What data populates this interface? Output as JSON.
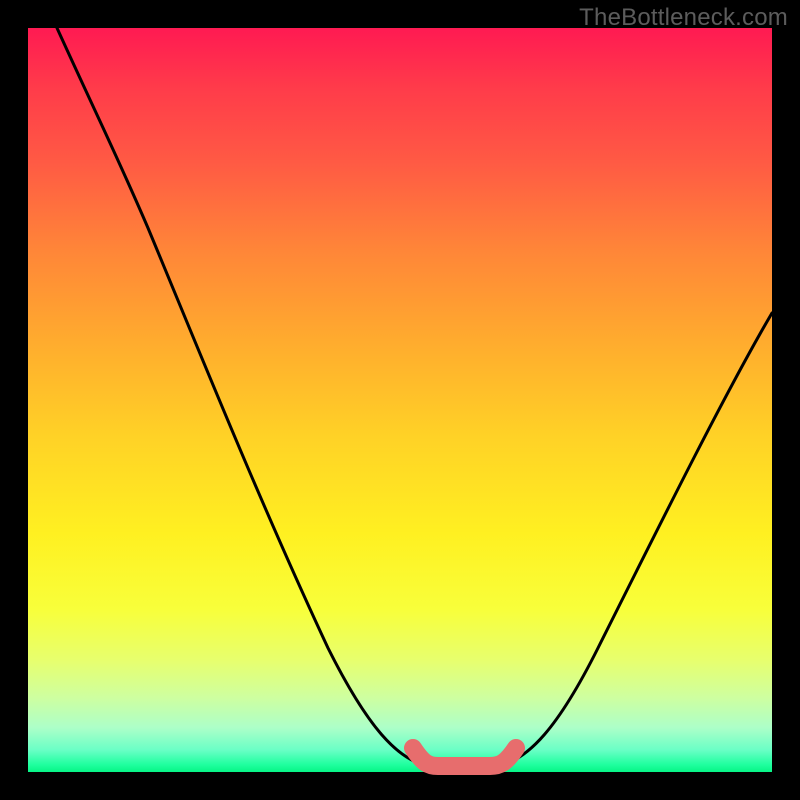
{
  "watermark": "TheBottleneck.com",
  "colors": {
    "page_bg": "#000000",
    "watermark": "#5c5c5c",
    "curve_stroke": "#000000",
    "highlight_stroke": "#e76d6d",
    "gradient_top": "#ff1a52",
    "gradient_bottom": "#06f586"
  },
  "chart_data": {
    "type": "line",
    "title": "",
    "xlabel": "",
    "ylabel": "",
    "xlim": [
      0,
      100
    ],
    "ylim": [
      0,
      100
    ],
    "grid": false,
    "series": [
      {
        "name": "bottleneck-curve",
        "x": [
          4,
          8,
          12,
          16,
          20,
          24,
          28,
          32,
          36,
          40,
          44,
          48,
          52,
          55,
          58,
          61,
          64,
          68,
          72,
          76,
          80,
          84,
          88,
          92,
          96,
          100
        ],
        "y": [
          100,
          93,
          85,
          77,
          69,
          62,
          54,
          46,
          38,
          30,
          22,
          14,
          7,
          3,
          1,
          1,
          3,
          8,
          15,
          22,
          29,
          36,
          42,
          47,
          52,
          56
        ]
      }
    ],
    "annotations": [
      {
        "name": "optimal-range",
        "x_range": [
          52,
          64
        ],
        "y": 1
      }
    ]
  }
}
